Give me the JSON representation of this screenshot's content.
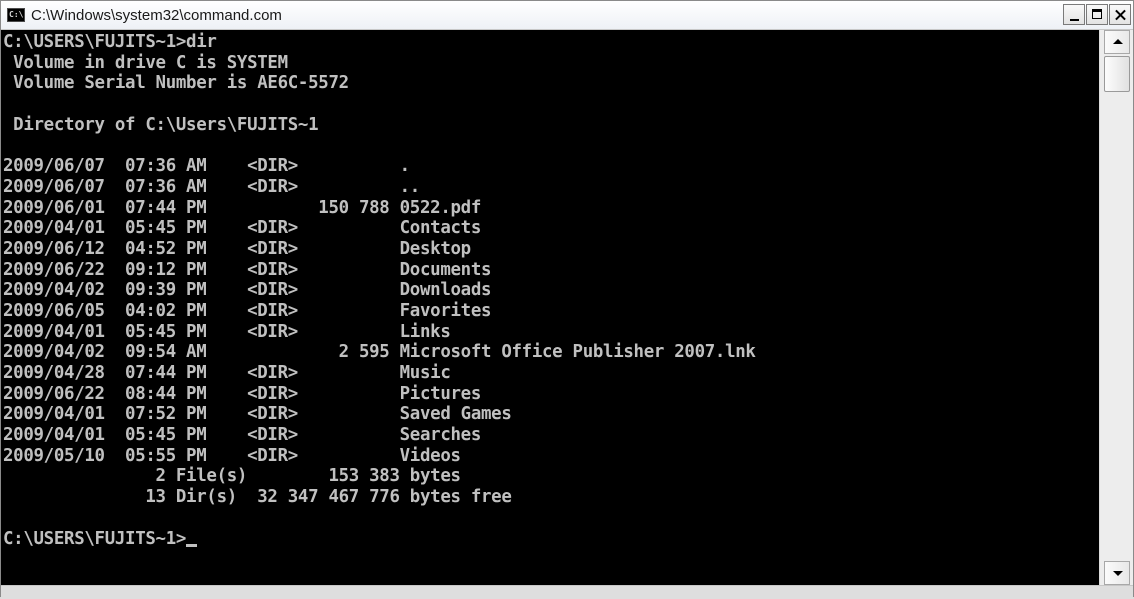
{
  "window": {
    "title": "C:\\Windows\\system32\\command.com",
    "icon": "console-icon",
    "icon_text": "C:\\"
  },
  "console": {
    "lines": [
      "C:\\USERS\\FUJITS~1>dir",
      " Volume in drive C is SYSTEM",
      " Volume Serial Number is AE6C-5572",
      "",
      " Directory of C:\\Users\\FUJITS~1",
      "",
      "2009/06/07  07:36 AM    <DIR>          .",
      "2009/06/07  07:36 AM    <DIR>          ..",
      "2009/06/01  07:44 PM           150 788 0522.pdf",
      "2009/04/01  05:45 PM    <DIR>          Contacts",
      "2009/06/12  04:52 PM    <DIR>          Desktop",
      "2009/06/22  09:12 PM    <DIR>          Documents",
      "2009/04/02  09:39 PM    <DIR>          Downloads",
      "2009/06/05  04:02 PM    <DIR>          Favorites",
      "2009/04/01  05:45 PM    <DIR>          Links",
      "2009/04/02  09:54 AM             2 595 Microsoft Office Publisher 2007.lnk",
      "2009/04/28  07:44 PM    <DIR>          Music",
      "2009/06/22  08:44 PM    <DIR>          Pictures",
      "2009/04/01  07:52 PM    <DIR>          Saved Games",
      "2009/04/01  05:45 PM    <DIR>          Searches",
      "2009/05/10  05:55 PM    <DIR>          Videos",
      "               2 File(s)        153 383 bytes",
      "              13 Dir(s)  32 347 467 776 bytes free",
      "",
      "C:\\USERS\\FUJITS~1>"
    ]
  },
  "colors": {
    "console_bg": "#000000",
    "console_fg": "#c0c0c0"
  }
}
